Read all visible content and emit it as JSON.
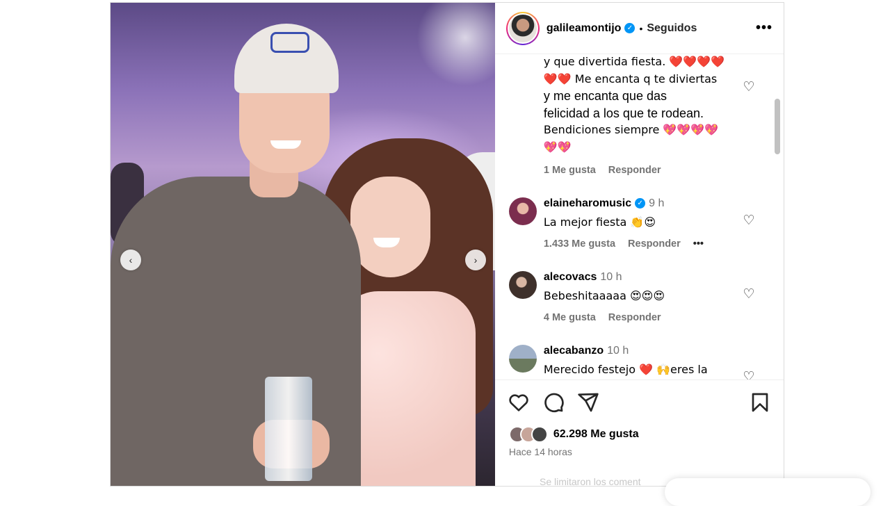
{
  "post": {
    "username": "galileamontijo",
    "follow_status": "Seguidos",
    "more_label": "•••"
  },
  "comments": {
    "first": {
      "text_lines": [
        "y que divertida fiesta. ❤️❤️❤️❤️",
        "❤️❤️ Me encanta q te diviertas",
        "y me encanta que das",
        "felicidad a los que te rodean.",
        "Bendiciones siempre 💖💖💖💖",
        "💖💖"
      ],
      "likes": "1 Me gusta",
      "reply": "Responder"
    },
    "list": [
      {
        "user": "elaineharomusic",
        "verified": true,
        "time": "9 h",
        "text": "La mejor fiesta 👏😍",
        "likes": "1.433 Me gusta",
        "reply": "Responder",
        "more": "•••",
        "avatar_color": "#7b2d4e"
      },
      {
        "user": "alecovacs",
        "verified": false,
        "time": "10 h",
        "text": "Bebeshitaaaaa 😍😍😍",
        "likes": "4 Me gusta",
        "reply": "Responder",
        "avatar_color": "#4b3a33"
      },
      {
        "user": "alecabanzo",
        "verified": false,
        "time": "10 h",
        "text": "Merecido festejo ❤️ 🙌eres la",
        "avatar_color": "#6b7a8f"
      }
    ]
  },
  "actions": {
    "like_icon": "heart-icon",
    "comment_icon": "comment-icon",
    "share_icon": "send-icon",
    "save_icon": "bookmark-icon"
  },
  "likes": {
    "count": "62.298 Me gusta",
    "time_ago": "Hace 14 horas"
  },
  "footer": {
    "limit_text": "Se limitaron los coment"
  },
  "nav": {
    "prev": "‹",
    "next": "›"
  }
}
